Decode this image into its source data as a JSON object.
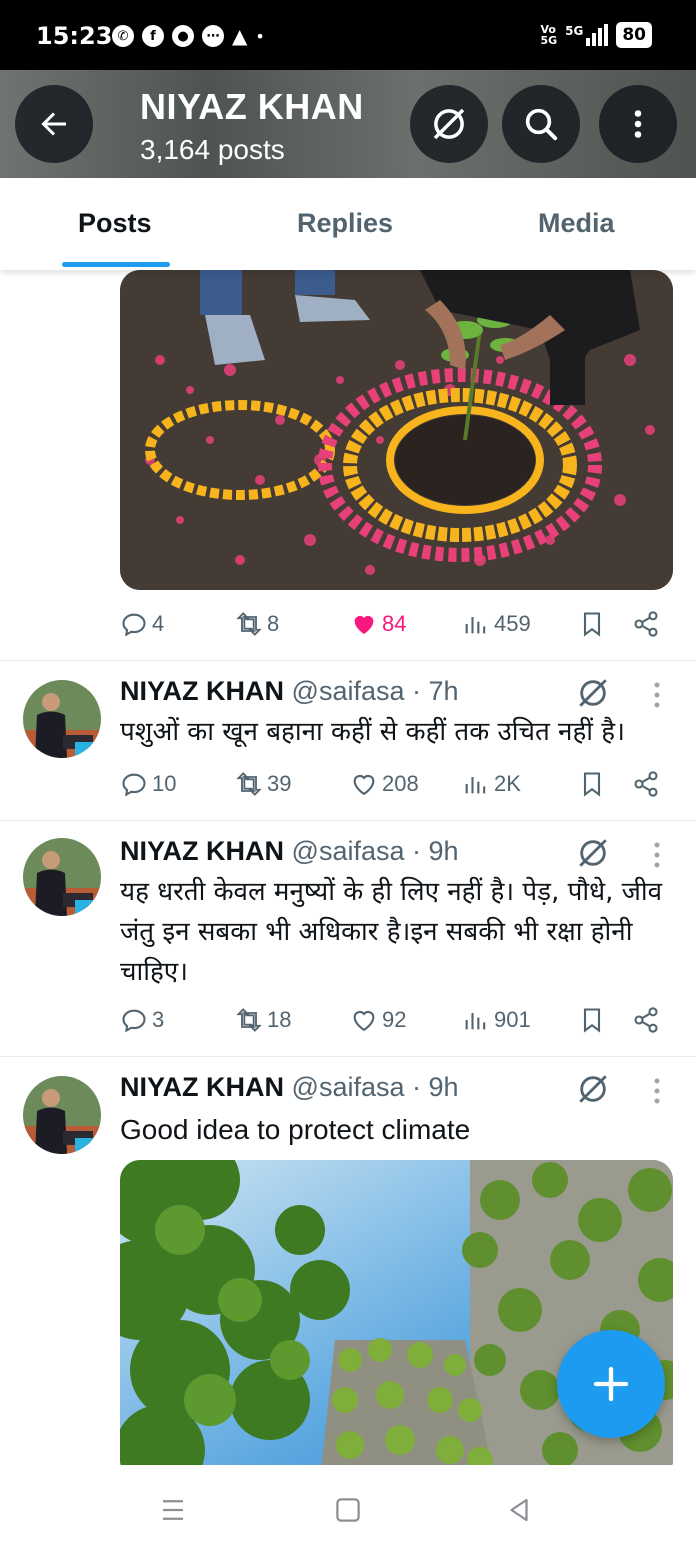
{
  "status_bar": {
    "time": "15:23",
    "network_label_top": "Vo",
    "network_label_bottom": "5G",
    "network_type": "5G",
    "battery": "80",
    "notification_icons": [
      "whatsapp-icon",
      "facebook-icon",
      "chat-icon",
      "message-icon",
      "drive-icon",
      "dot-icon"
    ]
  },
  "header": {
    "name": "NIYAZ KHAN",
    "posts_count": "3,164 posts"
  },
  "tabs": [
    {
      "label": "Posts",
      "active": true
    },
    {
      "label": "Replies",
      "active": false
    },
    {
      "label": "Media",
      "active": false
    }
  ],
  "tweets": [
    {
      "id": "t0",
      "partial": true,
      "media_description_icon": "photo",
      "actions": {
        "replies": "4",
        "retweets": "8",
        "likes": "84",
        "views": "459",
        "liked": true
      }
    },
    {
      "id": "t1",
      "name": "NIYAZ KHAN",
      "handle": "@saifasa",
      "time": "· 7h",
      "text": "पशुओं का खून बहाना कहीं से कहीं तक उचित नहीं है।",
      "actions": {
        "replies": "10",
        "retweets": "39",
        "likes": "208",
        "views": "2K",
        "liked": false
      }
    },
    {
      "id": "t2",
      "name": "NIYAZ KHAN",
      "handle": "@saifasa",
      "time": "· 9h",
      "text": "यह धरती केवल मनुष्यों के ही लिए नहीं है। पेड़, पौधे, जीव जंतु इन सबका भी अधिकार है।इन सबकी भी रक्षा होनी चाहिए।",
      "actions": {
        "replies": "3",
        "retweets": "18",
        "likes": "92",
        "views": "901",
        "liked": false
      }
    },
    {
      "id": "t3",
      "name": "NIYAZ KHAN",
      "handle": "@saifasa",
      "time": "· 9h",
      "text": "Good idea to protect climate"
    }
  ],
  "colors": {
    "accent": "#1d9bf0",
    "like": "#f91880",
    "muted": "#536471",
    "text": "#0f1419"
  }
}
